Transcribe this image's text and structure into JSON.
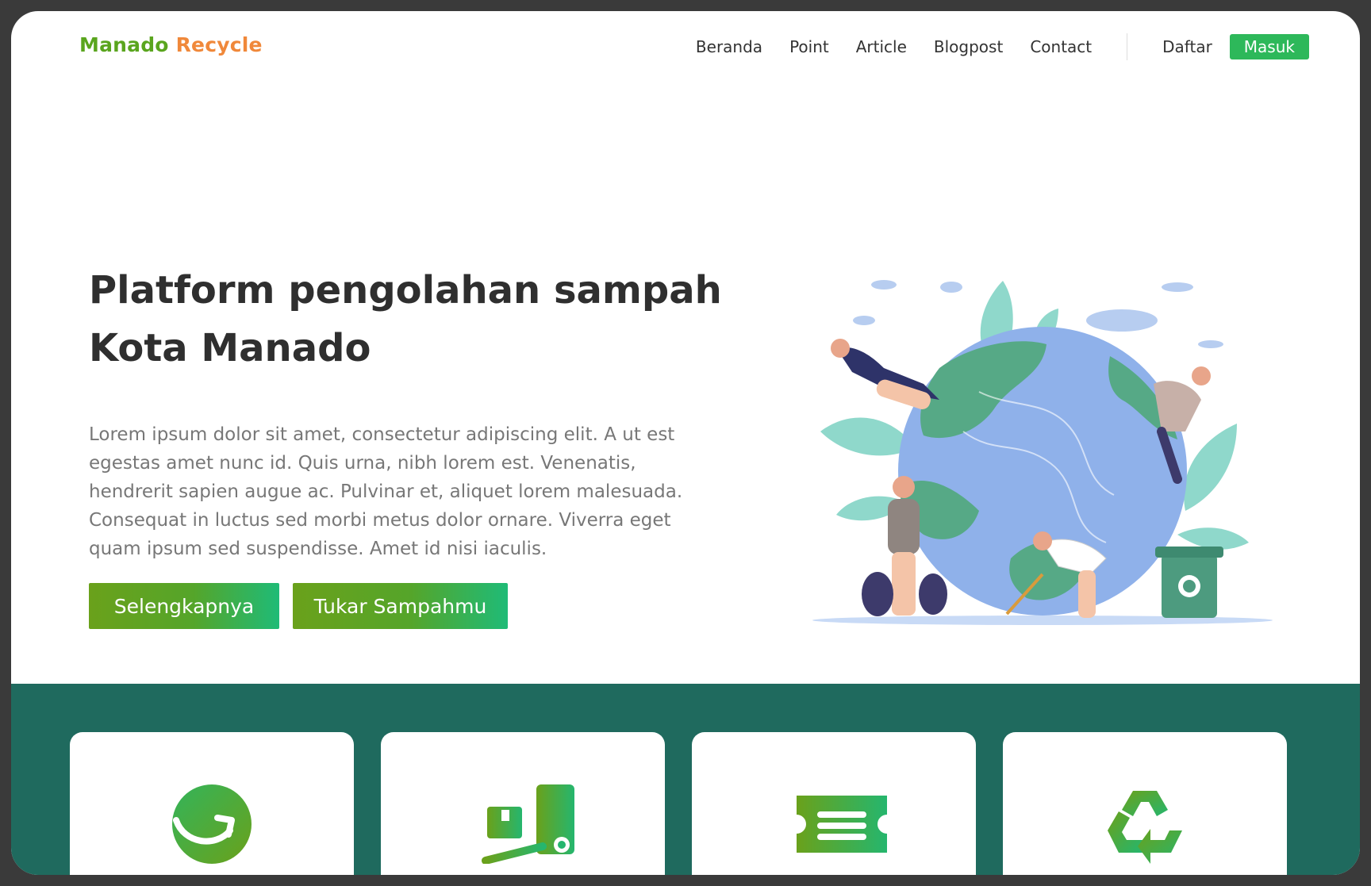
{
  "brand": {
    "part1": "Manado",
    "part2": "Recycle"
  },
  "nav": {
    "items": [
      "Beranda",
      "Point",
      "Article",
      "Blogpost",
      "Contact"
    ],
    "register": "Daftar",
    "login": "Masuk"
  },
  "hero": {
    "title_line1": "Platform pengolahan sampah",
    "title_line2": "Kota Manado",
    "description": "Lorem ipsum dolor sit amet, consectetur adipiscing elit. A ut est egestas amet nunc id. Quis urna, nibh lorem est. Venenatis, hendrerit sapien augue ac. Pulvinar et, aliquet lorem malesuada. Consequat in luctus sed morbi metus dolor ornare. Viverra eget quam ipsum sed suspendisse. Amet id nisi iaculis.",
    "btn_more": "Selengkapnya",
    "btn_exchange": "Tukar Sampahmu"
  },
  "features": {
    "icons": [
      "redo-arrow-icon",
      "delivery-truck-icon",
      "ticket-icon",
      "recycle-icon"
    ]
  },
  "colors": {
    "brand_green": "#5aa51e",
    "brand_orange": "#f0883a",
    "band": "#1f6a5e",
    "button_start": "#6aa11b",
    "button_end": "#1fbb77"
  }
}
